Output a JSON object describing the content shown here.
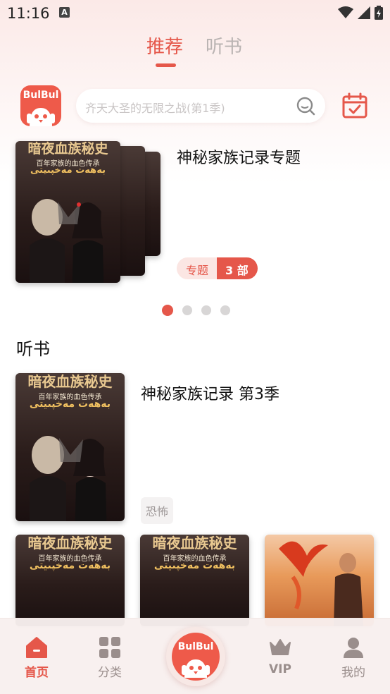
{
  "status_bar": {
    "time": "11:16",
    "notification_letter": "A"
  },
  "top_tabs": {
    "recommend": "推荐",
    "audiobooks": "听书"
  },
  "app_logo_text": "BulBul",
  "search": {
    "placeholder": "齐天大圣的无限之战(第1季)"
  },
  "featured": {
    "title": "神秘家族记录专题",
    "badge_tag": "专题",
    "badge_count": "3 部",
    "carousel_pages": 4,
    "active_page": 1
  },
  "cover_art": {
    "main_title": "暗夜血族秘史",
    "subtitle": "百年家族的血色传承",
    "foreign_title": "بەھەت مەخپىيتى"
  },
  "section": {
    "title": "听书"
  },
  "book": {
    "title": "神秘家族记录 第3季",
    "tag": "恐怖"
  },
  "bottom_nav": {
    "home": "首页",
    "categories": "分类",
    "vip": "VIP",
    "mine": "我的",
    "center_logo": "BulBul"
  },
  "colors": {
    "accent": "#e5574a",
    "logo_bg": "#ee5a4a",
    "inactive": "#9a8e8c"
  }
}
